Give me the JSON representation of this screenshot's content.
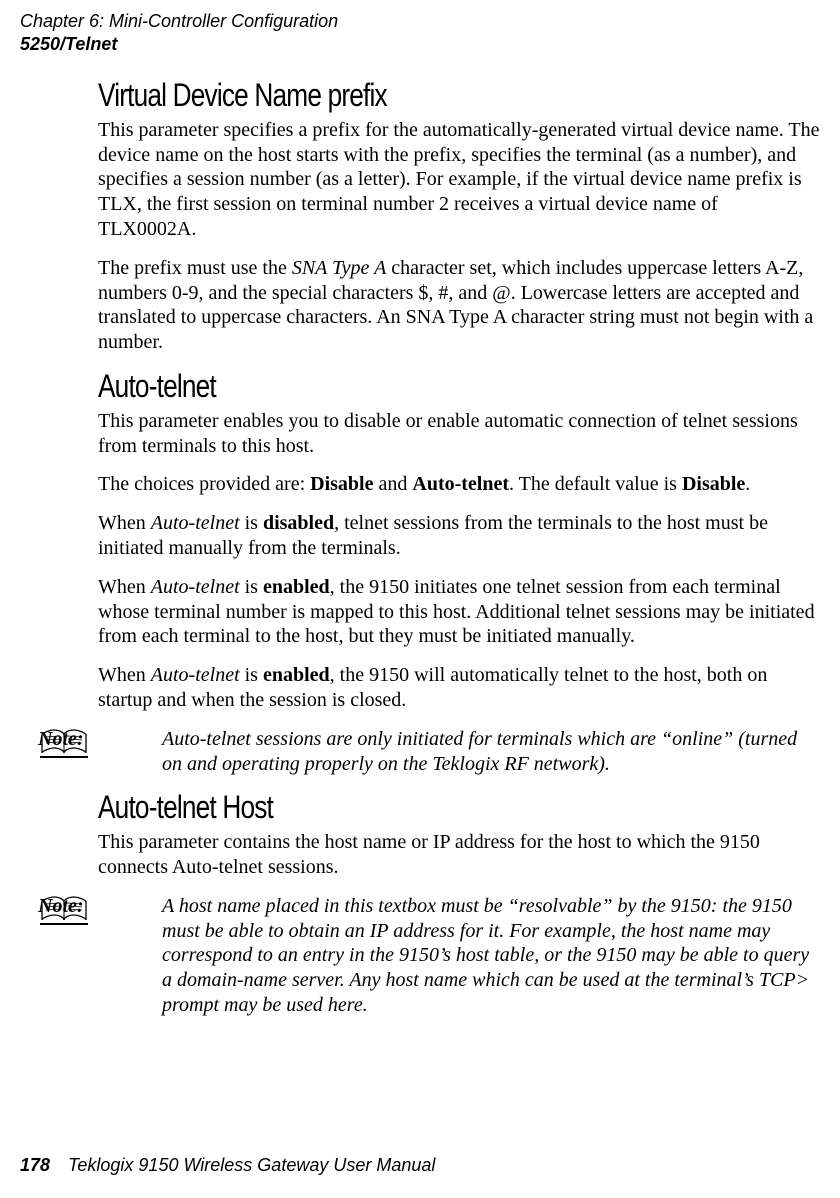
{
  "header": {
    "chapter": "Chapter 6:  Mini-Controller Configuration",
    "section": "5250/Telnet"
  },
  "sections": {
    "s1": {
      "title": "Virtual Device Name prefix",
      "p1": "This parameter specifies a prefix for the automatically-generated virtual device name. The device name on the host starts with the prefix, specifies the terminal (as a number), and specifies a session number (as a letter). For example, if the virtual device name prefix is TLX, the first session on terminal number 2 receives a virtual device name of TLX0002A.",
      "p2_a": "The prefix must use the ",
      "p2_ital": "SNA Type A",
      "p2_b": " character set, which includes uppercase letters A-Z, numbers 0-9, and the special characters $, #, and @. Lowercase letters are accepted and translated to uppercase characters. An SNA Type A character string must not begin with a number."
    },
    "s2": {
      "title": "Auto-telnet",
      "p1": "This parameter enables you to disable or enable automatic connection of telnet sessions from terminals to this host.",
      "p2_a": "The choices provided are: ",
      "p2_b1": "Disable",
      "p2_b": " and ",
      "p2_b2": "Auto-telnet",
      "p2_c": ". The default value is ",
      "p2_b3": "Disable",
      "p2_d": ".",
      "p3_a": "When ",
      "p3_ital": "Auto-telnet",
      "p3_b": " is ",
      "p3_bold": "disabled",
      "p3_c": ", telnet sessions from the terminals to the host must be initiated manually from the terminals.",
      "p4_a": "When ",
      "p4_ital": "Auto-telnet",
      "p4_b": " is ",
      "p4_bold": "enabled",
      "p4_c": ", the 9150 initiates one telnet session from each termi­nal whose terminal number is mapped to this host. Additional telnet sessions may be initiated from each terminal to the host, but they must be initiated manually.",
      "p5_a": "When ",
      "p5_ital": "Auto-telnet",
      "p5_b": " is ",
      "p5_bold": "enabled",
      "p5_c": ", the 9150 will automatically telnet to the host, both on startup and when the session is closed."
    },
    "note1": {
      "label": "Note:",
      "text": "Auto-telnet sessions are only initiated for terminals which are “online” (turned on and operating properly on the Teklogix RF network)."
    },
    "s3": {
      "title": "Auto-telnet Host",
      "p1": "This parameter contains the host name or IP address for the host to which the 9150 connects Auto-telnet sessions."
    },
    "note2": {
      "label": "Note:",
      "text": "A host name placed in this textbox must be “resolvable” by the 9150: the 9150 must be able to obtain an IP address for it. For example, the host name may correspond to an entry in the 9150’s host table, or the 9150 may be able to query a domain-name server. Any host name which can be used at the terminal’s TCP> prompt may be used here."
    },
    "footer": {
      "page": "178",
      "title": "Teklogix 9150 Wireless Gateway User Manual"
    }
  }
}
